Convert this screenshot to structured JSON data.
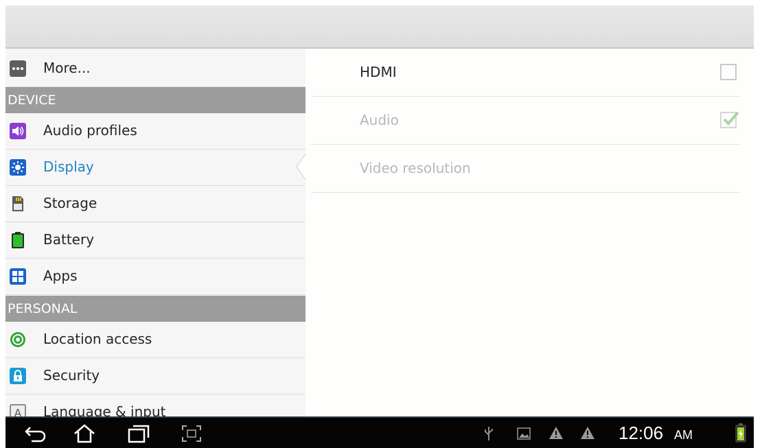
{
  "action_bar": {},
  "sidebar": {
    "items": [
      {
        "label": "More...",
        "icon": "more-icon"
      },
      {
        "section": "DEVICE"
      },
      {
        "label": "Audio profiles",
        "icon": "audio-profiles-icon"
      },
      {
        "label": "Display",
        "icon": "display-icon",
        "selected": true
      },
      {
        "label": "Storage",
        "icon": "storage-icon"
      },
      {
        "label": "Battery",
        "icon": "battery-icon"
      },
      {
        "label": "Apps",
        "icon": "apps-icon"
      },
      {
        "section": "PERSONAL"
      },
      {
        "label": "Location access",
        "icon": "location-icon"
      },
      {
        "label": "Security",
        "icon": "lock-icon"
      },
      {
        "label": "Language & input",
        "icon": "language-icon"
      }
    ]
  },
  "detail": {
    "hdmi": {
      "label": "HDMI",
      "checked": false,
      "enabled": true
    },
    "audio": {
      "label": "Audio",
      "checked": true,
      "enabled": false
    },
    "video_resolution": {
      "label": "Video resolution",
      "enabled": false
    }
  },
  "navbar": {
    "time": "12:06",
    "ampm": "AM",
    "icons": [
      "back-icon",
      "home-icon",
      "recent-apps-icon",
      "screenshot-icon",
      "usb-icon",
      "image-icon",
      "warning-icon",
      "warning-icon",
      "battery-charging-icon"
    ]
  },
  "colors": {
    "accent": "#1f86c4",
    "header": "#9c9c9c",
    "navbar": "#050505"
  }
}
